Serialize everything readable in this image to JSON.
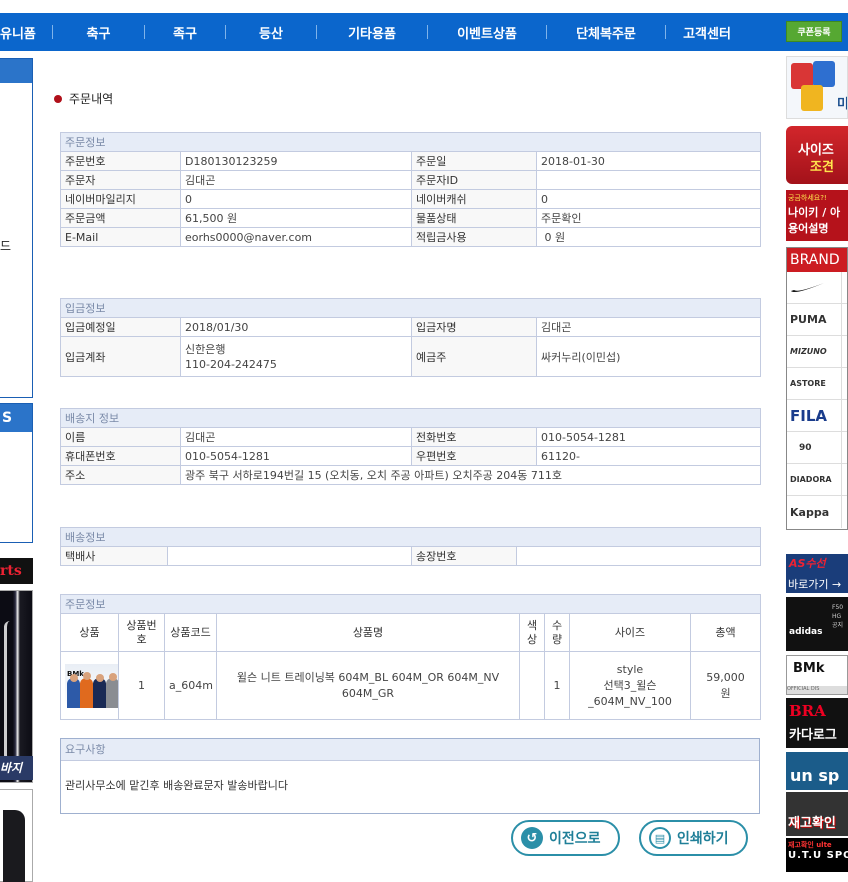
{
  "nav": {
    "items": [
      "유니폼",
      "축구",
      "족구",
      "등산",
      "기타용품",
      "이벤트상품",
      "단체복주문",
      "고객센터"
    ],
    "coupon": "쿠폰등록"
  },
  "left": {
    "box2_header": "S",
    "frag": "드",
    "rts": "rts",
    "pants": "바지"
  },
  "page_title": "주문내역",
  "order_info": {
    "section": "주문정보",
    "rows": [
      [
        "주문번호",
        "D180130123259",
        "주문일",
        "2018-01-30"
      ],
      [
        "주문자",
        "김대곤",
        "주문자ID",
        ""
      ],
      [
        "네이버마일리지",
        "0",
        "네이버캐쉬",
        "0"
      ],
      [
        "주문금액",
        "61,500 원",
        "물품상태",
        "주문확인"
      ],
      [
        "E-Mail",
        "eorhs0000@naver.com",
        "적립금사용",
        " 0 원"
      ]
    ]
  },
  "payment_info": {
    "section": "입금정보",
    "row1": [
      "입금예정일",
      "2018/01/30",
      "입금자명",
      "김대곤"
    ],
    "row2": {
      "label": "입금계좌",
      "bank": "신한은행",
      "account": "110-204-242475",
      "label2": "예금주",
      "holder": "싸커누리(이민섭)"
    }
  },
  "shipping_addr": {
    "section": "배송지 정보",
    "rows": [
      [
        "이름",
        "김대곤",
        "전화번호",
        "010-5054-1281"
      ],
      [
        "휴대폰번호",
        "010-5054-1281",
        "우편번호",
        "61120-"
      ]
    ],
    "address_label": "주소",
    "address": "광주 북구 서하로194번길 15 (오치동, 오치 주공 아파트) 오치주공 204동 711호"
  },
  "delivery_info": {
    "section": "배송정보",
    "carrier_label": "택배사",
    "carrier": "",
    "tracking_label": "송장번호",
    "tracking": ""
  },
  "order_items": {
    "section": "주문정보",
    "headers": [
      "상품",
      "상품번호",
      "상품코드",
      "상품명",
      "색상",
      "수량",
      "사이즈",
      "총액"
    ],
    "items": [
      {
        "no": "1",
        "code": "a_604m",
        "name": "윌슨 니트 트레이닝복 604M_BL 604M_OR 604M_NV 604M_GR",
        "color": "",
        "qty": "1",
        "size_line1": "style",
        "size_line2": "선택3_윌슨",
        "size_line3": "_604M_NV_100",
        "total_line1": "59,000",
        "total_line2": "원",
        "thumb_brand": "BMk"
      }
    ]
  },
  "request": {
    "section": "요구사항",
    "text": "관리사무소에 맡긴후 배송완료문자 발송바랍니다"
  },
  "buttons": {
    "back": "이전으로",
    "print": "인쇄하기"
  },
  "right": {
    "paint_text": "미",
    "size_t1": "사이즈",
    "size_t2": "조견",
    "nike_a": "궁금하세요?!",
    "nike_b": "나이키 / 아",
    "nike_c": "용어설명",
    "brand_header": "BRAND",
    "brands": [
      "NIKE",
      "PUMA",
      "MIZUNO",
      "ASTORE",
      "FILA",
      "90",
      "DIADORA",
      "Kappa"
    ],
    "as_text": "AS수선",
    "as_go": "바로가기 →",
    "adidas": "adidas",
    "adidas_side": "F50 HG 공지",
    "bmk": "BMk",
    "bmk_sub": "OFFICIAL DIS",
    "bra_t1": "BRA",
    "bra_t2": "카다로그",
    "unsp": "un sp",
    "stock": "재고확인",
    "utu_t1": "재고확인 ulte",
    "utu_t2": "U.T.U SPO"
  },
  "colors": {
    "nav_bg": "#0b66cc",
    "section_bg": "#e6ecf7",
    "accent_button": "#2b8fa8",
    "bullet": "#b0101a"
  }
}
